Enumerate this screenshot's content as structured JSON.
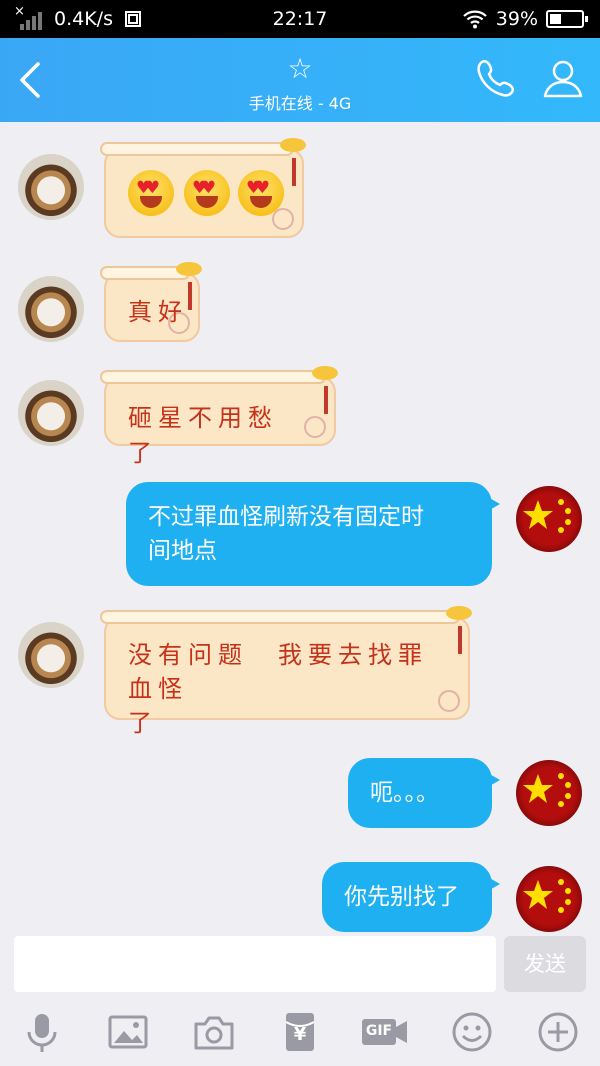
{
  "status_bar": {
    "network_speed": "0.4K/s",
    "time": "22:17",
    "battery": "39%",
    "battery_level": 0.39
  },
  "header": {
    "star_glyph": "☆",
    "subtitle": "手机在线 - 4G"
  },
  "messages": [
    {
      "side": "left",
      "type": "emoji",
      "emojis": [
        "heart-eyes-emoji",
        "heart-eyes-emoji",
        "heart-eyes-emoji"
      ]
    },
    {
      "side": "left",
      "type": "scroll",
      "text": "真好"
    },
    {
      "side": "left",
      "type": "scroll",
      "text": "砸星不用愁了"
    },
    {
      "side": "right",
      "type": "bubble",
      "lines": [
        "不过罪血怪刷新没有固定时",
        "间地点"
      ]
    },
    {
      "side": "left",
      "type": "scroll",
      "lines": [
        "没有问题　我要去找罪血怪",
        "了"
      ]
    },
    {
      "side": "right",
      "type": "bubble",
      "text": "呃。。。"
    },
    {
      "side": "right",
      "type": "bubble",
      "text": "你先别找了"
    }
  ],
  "input": {
    "value": "",
    "send_label": "发送"
  },
  "toolbar": {
    "icons": [
      "microphone-icon",
      "image-icon",
      "camera-icon",
      "red-packet-icon",
      "gif-icon",
      "emoji-icon",
      "plus-icon"
    ],
    "gif_label": "GIF",
    "yen": "¥"
  },
  "colors": {
    "accent": "#33b8fb",
    "bubble": "#1fb0f2",
    "scroll_bg": "#fbe6c6",
    "scroll_text": "#c5321a"
  }
}
